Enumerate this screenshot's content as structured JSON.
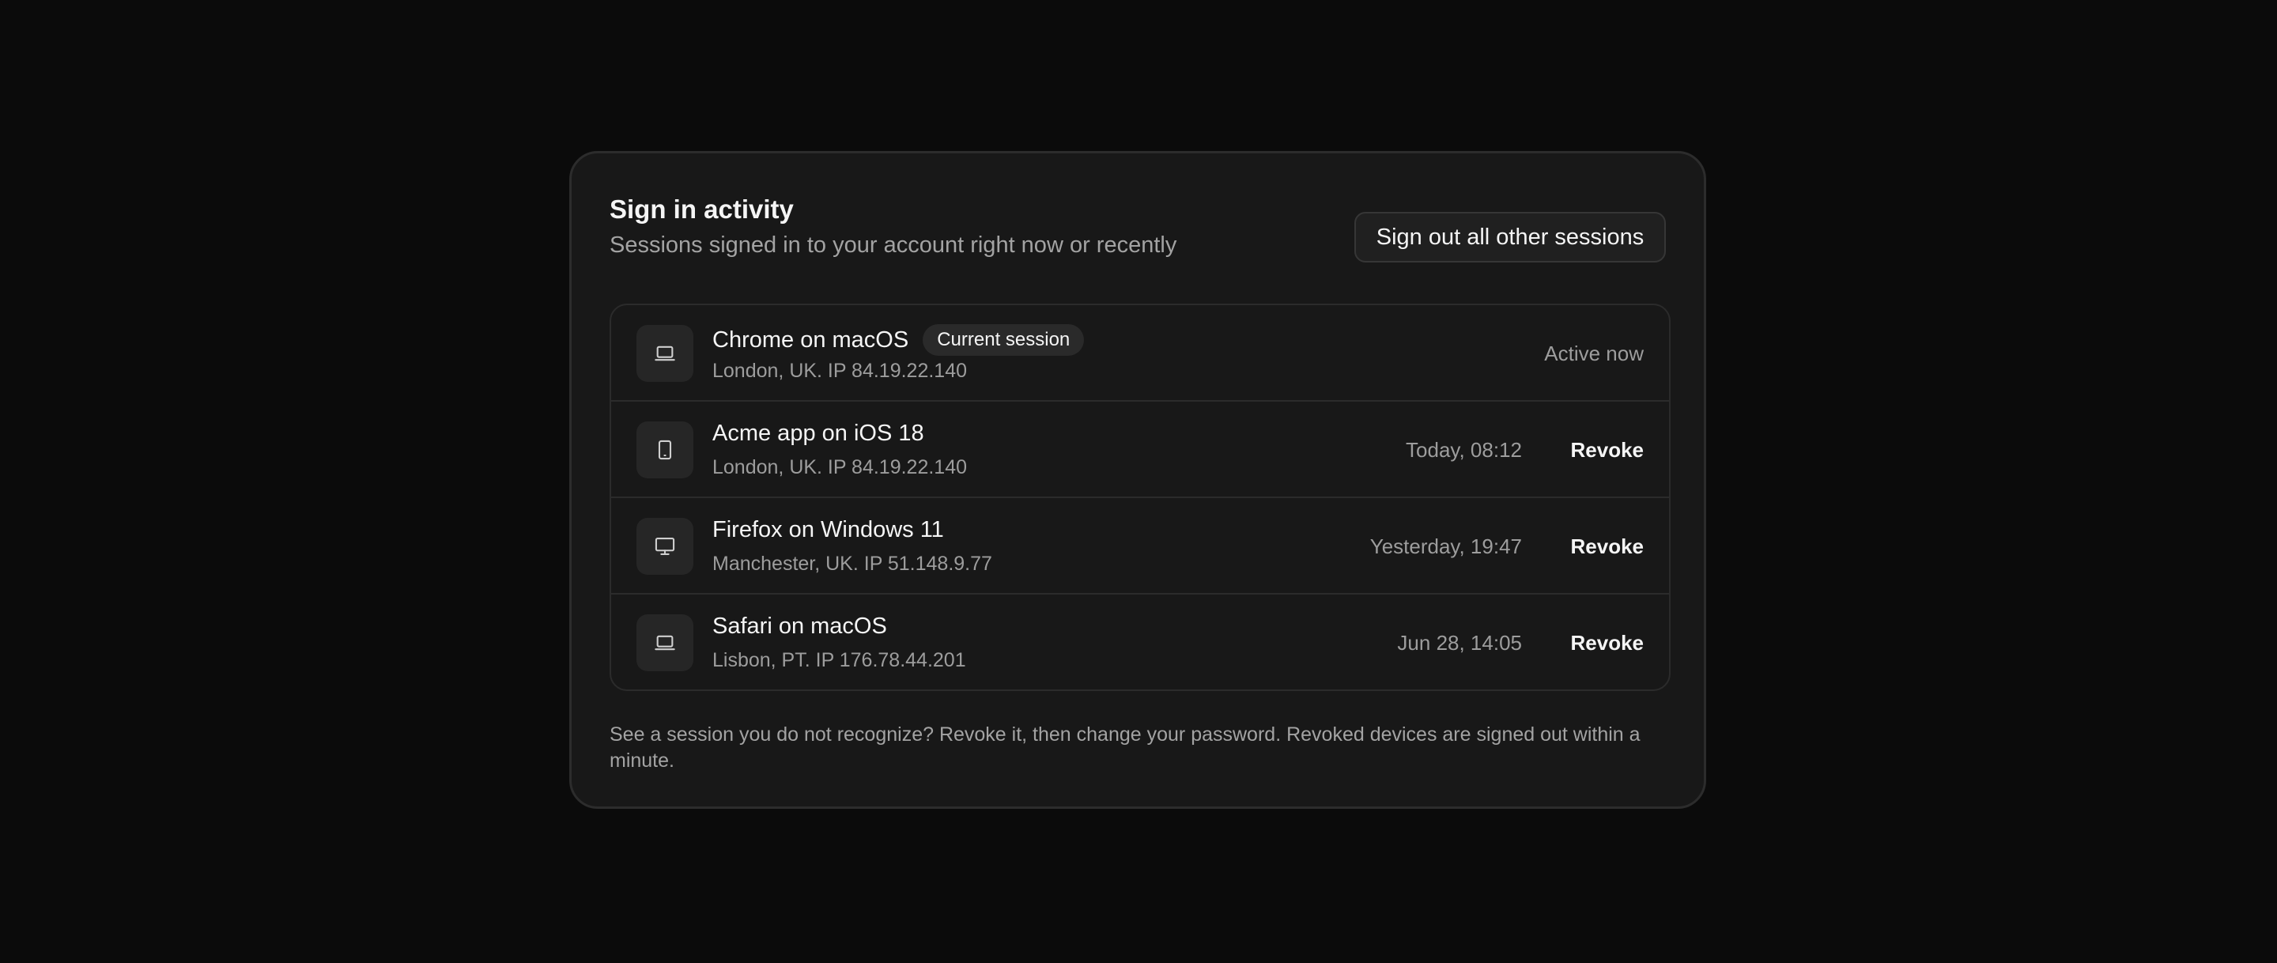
{
  "card": {
    "title": "Sign in activity",
    "subtitle": "Sessions signed in to your account right now or recently",
    "signout_all_label": "Sign out all other sessions",
    "footer_note": "See a session you do not recognize? Revoke it, then change your password. Revoked devices are signed out within a minute."
  },
  "sessions": [
    {
      "icon": "laptop-icon",
      "name": "Chrome on macOS",
      "badge": "Current session",
      "location": "London, UK. IP 84.19.22.140",
      "last_active": "Active now"
    },
    {
      "icon": "phone-icon",
      "name": "Acme app on iOS 18",
      "location": "London, UK. IP 84.19.22.140",
      "last_active": "Today, 08:12",
      "action_label": "Revoke"
    },
    {
      "icon": "monitor-icon",
      "name": "Firefox on Windows 11",
      "location": "Manchester, UK. IP 51.148.9.77",
      "last_active": "Yesterday, 19:47",
      "action_label": "Revoke"
    },
    {
      "icon": "laptop-icon",
      "name": "Safari on macOS",
      "location": "Lisbon, PT. IP 176.78.44.201",
      "last_active": "Jun 28, 14:05",
      "action_label": "Revoke"
    }
  ]
}
